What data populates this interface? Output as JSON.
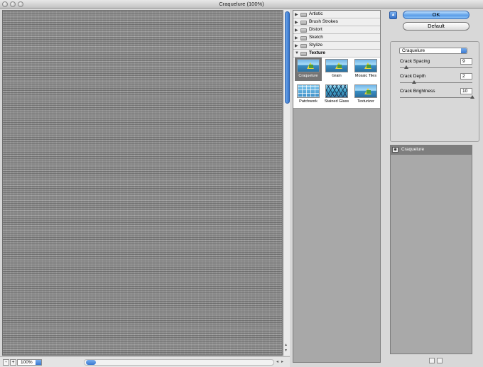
{
  "window": {
    "title": "Craquelure (100%)"
  },
  "preview": {
    "zoom": "100%",
    "scroll_left_glyph": "◂",
    "scroll_right_glyph": "▸",
    "scroll_up_glyph": "▴",
    "scroll_down_glyph": "▾"
  },
  "bottom": {
    "minus_label": "-",
    "plus_label": "+"
  },
  "categories": [
    {
      "label": "Artistic",
      "expanded": false
    },
    {
      "label": "Brush Strokes",
      "expanded": false
    },
    {
      "label": "Distort",
      "expanded": false
    },
    {
      "label": "Sketch",
      "expanded": false
    },
    {
      "label": "Stylize",
      "expanded": false
    },
    {
      "label": "Texture",
      "expanded": true
    }
  ],
  "texture_filters": [
    {
      "label": "Craquelure",
      "selected": true
    },
    {
      "label": "Grain",
      "selected": false
    },
    {
      "label": "Mosaic Tiles",
      "selected": false
    },
    {
      "label": "Patchwork",
      "selected": false
    },
    {
      "label": "Stained Glass",
      "selected": false
    },
    {
      "label": "Texturizer",
      "selected": false
    }
  ],
  "buttons": {
    "ok": "OK",
    "default": "Default"
  },
  "settings": {
    "filter": "Craquelure",
    "params": [
      {
        "label": "Crack Spacing",
        "value": "9",
        "level": 0.09
      },
      {
        "label": "Crack Depth",
        "value": "2",
        "level": 0.2
      },
      {
        "label": "Crack Brightness",
        "value": "10",
        "level": 1.0
      }
    ]
  },
  "layers": [
    {
      "label": "Craquelure",
      "visible": true
    }
  ],
  "colors": {
    "accent": "#3a78d0",
    "ok_button": "#5c9ee8",
    "preview_gray": "#8f8f8f"
  }
}
